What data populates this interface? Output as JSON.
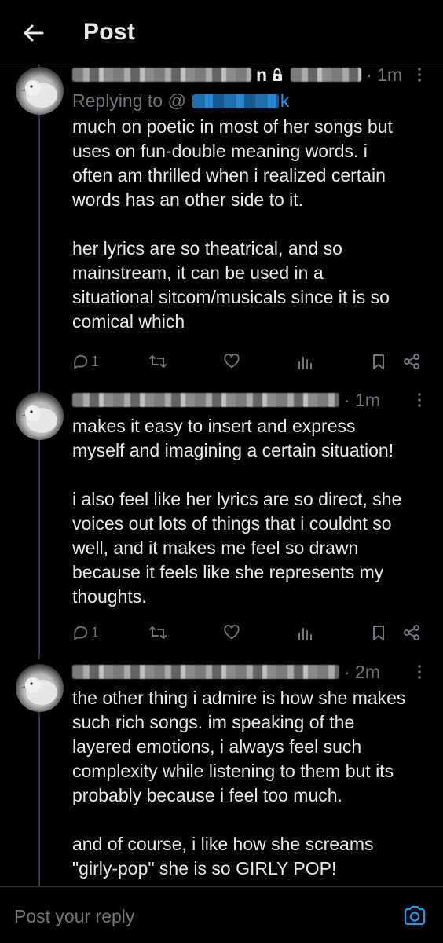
{
  "header": {
    "title": "Post",
    "back_icon": "arrow-left-icon"
  },
  "tweets": [
    {
      "name_suffix": "n",
      "time": "· 1m",
      "replying_label": "Replying to @",
      "replying_tail": "k",
      "lines": [
        "much on poetic in most of her songs but",
        "uses on fun-double meaning words. i",
        "often am thrilled when i realized certain",
        "words has an other side to it.",
        "",
        "her lyrics are so theatrical, and so",
        "mainstream, it can be used in a",
        "situational sitcom/musicals since it is so",
        "comical which"
      ],
      "reply_count": "1"
    },
    {
      "time": "· 1m",
      "lines": [
        "makes it easy to insert and express",
        "myself and imagining a certain situation!",
        "",
        "i also feel like her lyrics are so direct, she",
        "voices out lots of things that i couldnt so",
        "well, and it makes me feel so drawn",
        "because it feels like she represents my",
        "thoughts."
      ],
      "reply_count": "1"
    },
    {
      "time": "· 2m",
      "lines": [
        "the other thing i admire is how she makes",
        "such rich songs. im speaking of the",
        "layered emotions, i always feel such",
        "complexity while listening to them but its",
        "probably because i feel too much.",
        "",
        "and of course, i like how she screams",
        "\"girly-pop\" she is so GIRLY POP!"
      ]
    }
  ],
  "reply_bar": {
    "placeholder": "Post your reply",
    "camera_icon": "camera-icon"
  },
  "colors": {
    "background": "#000000",
    "text": "#e7e9ea",
    "muted": "#71767b",
    "accent": "#1d9bf0"
  }
}
